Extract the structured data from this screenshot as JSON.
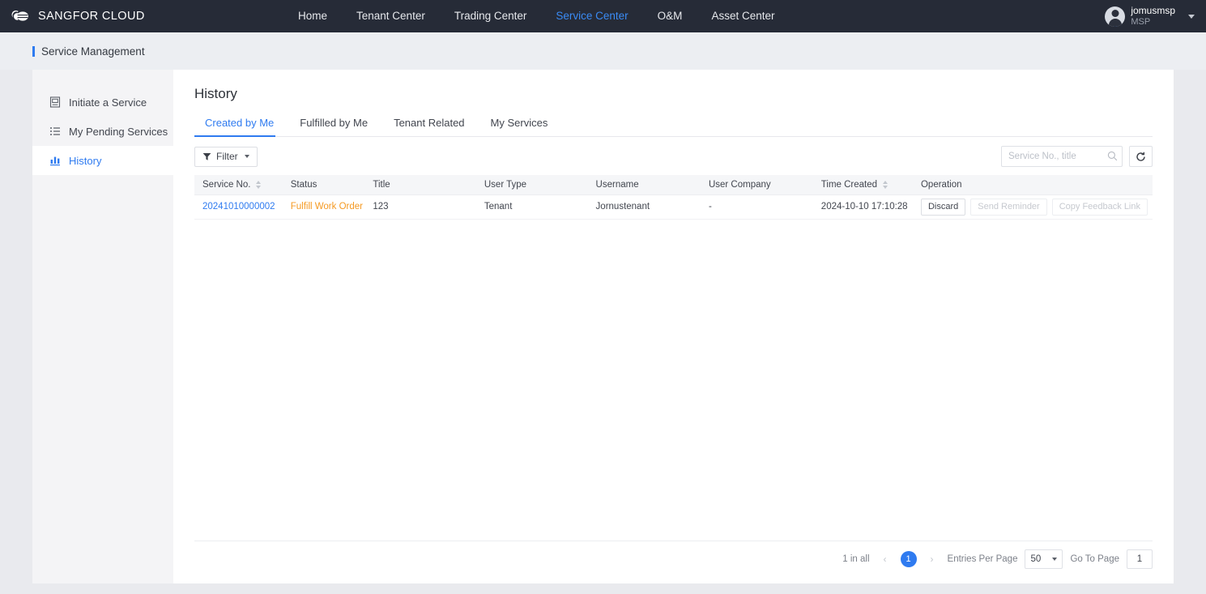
{
  "topbar": {
    "brand": "SANGFOR CLOUD",
    "logo_icon": "cloud-logo-icon",
    "nav": [
      {
        "label": "Home",
        "active": false
      },
      {
        "label": "Tenant Center",
        "active": false
      },
      {
        "label": "Trading Center",
        "active": false
      },
      {
        "label": "Service Center",
        "active": true
      },
      {
        "label": "O&M",
        "active": false
      },
      {
        "label": "Asset Center",
        "active": false
      }
    ],
    "user": {
      "name": "jomusmsp",
      "role": "MSP"
    },
    "accent": "#3a8bf5"
  },
  "breadcrumb": {
    "label": "Service Management",
    "accent": "#2f7bf0"
  },
  "sidebar": {
    "items": [
      {
        "label": "Initiate a Service",
        "icon": "form-icon",
        "active": false
      },
      {
        "label": "My Pending Services",
        "icon": "list-icon",
        "active": false
      },
      {
        "label": "History",
        "icon": "bar-chart-icon",
        "active": true
      }
    ]
  },
  "main": {
    "title": "History",
    "tabs": [
      {
        "label": "Created by Me",
        "active": true
      },
      {
        "label": "Fulfilled by Me",
        "active": false
      },
      {
        "label": "Tenant Related",
        "active": false
      },
      {
        "label": "My Services",
        "active": false
      }
    ],
    "toolbar": {
      "filter_label": "Filter",
      "search_placeholder": "Service No., title",
      "search_value": "",
      "refresh_icon": "refresh-icon",
      "search_icon": "search-icon"
    },
    "table": {
      "columns": [
        {
          "label": "Service No.",
          "sortable": true
        },
        {
          "label": "Status",
          "sortable": false
        },
        {
          "label": "Title",
          "sortable": false
        },
        {
          "label": "User Type",
          "sortable": false
        },
        {
          "label": "Username",
          "sortable": false
        },
        {
          "label": "User Company",
          "sortable": false
        },
        {
          "label": "Time Created",
          "sortable": true
        },
        {
          "label": "Operation",
          "sortable": false
        }
      ],
      "rows": [
        {
          "service_no": "20241010000002",
          "status": "Fulfill Work Order",
          "title": "123",
          "user_type": "Tenant",
          "username": "Jornustenant",
          "user_company": "-",
          "time_created": "2024-10-10 17:10:28",
          "operations": [
            {
              "label": "Discard",
              "disabled": false
            },
            {
              "label": "Send Reminder",
              "disabled": true
            },
            {
              "label": "Copy Feedback Link",
              "disabled": true
            }
          ]
        }
      ]
    },
    "pagination": {
      "total_label": "1 in all",
      "prev": "‹",
      "next": "›",
      "current_page": "1",
      "entries_label": "Entries Per Page",
      "entries_value": "50",
      "goto_label": "Go To Page",
      "goto_value": "1"
    }
  },
  "colors": {
    "link": "#2f7bf0",
    "status_orange": "#f59a23",
    "topbar_bg": "#262b37"
  }
}
